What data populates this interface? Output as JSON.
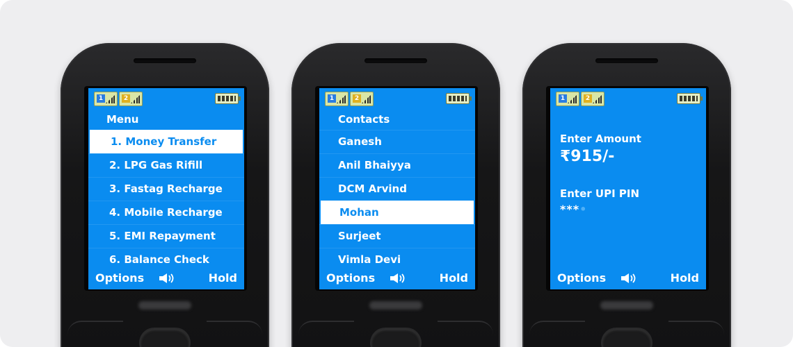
{
  "phones": [
    {
      "screen": "menu",
      "title": "Menu",
      "items": [
        "1. Money Transfer",
        "2. LPG Gas Rifill",
        "3. Fastag Recharge",
        "4. Mobile Recharge",
        "5. EMI Repayment",
        "6. Balance Check"
      ],
      "softkeys": {
        "left": "Options",
        "right": "Hold"
      }
    },
    {
      "screen": "contacts",
      "items": [
        "Contacts",
        "Ganesh",
        "Anil Bhaiyya",
        "DCM Arvind",
        "Mohan",
        "Surjeet",
        "Vimla Devi"
      ],
      "softkeys": {
        "left": "Options",
        "right": "Hold"
      }
    },
    {
      "screen": "payment",
      "amount_label": "Enter Amount",
      "amount_value": "₹915/-",
      "pin_label": "Enter UPI PIN",
      "pin_value": "***",
      "softkeys": {
        "left": "Options",
        "right": "Hold"
      }
    }
  ],
  "colors": {
    "screen_bg": "#0a8cf0",
    "selection_bg": "#ffffff",
    "selection_text": "#0a8cf0",
    "body_bg": "#eeeef0"
  },
  "icons": [
    "signal-icon",
    "battery-icon",
    "speaker-icon"
  ]
}
